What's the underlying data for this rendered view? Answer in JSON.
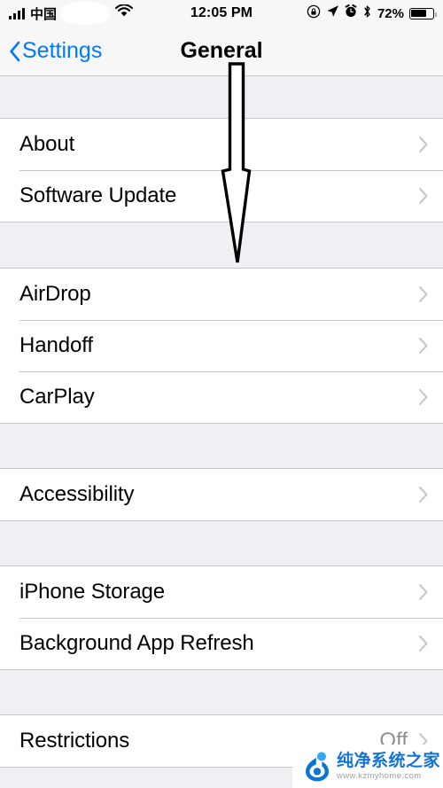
{
  "status_bar": {
    "carrier": "中国",
    "signal_icon": "signal-bars-icon",
    "wifi_icon": "wifi-icon",
    "time": "12:05 PM",
    "rotation_lock_icon": "rotation-lock-icon",
    "location_icon": "location-arrow-icon",
    "alarm_icon": "alarm-clock-icon",
    "bluetooth_icon": "bluetooth-icon",
    "battery_percent": "72%",
    "battery_level": 72
  },
  "nav_bar": {
    "back_label": "Settings",
    "back_icon": "chevron-left-icon",
    "title": "General"
  },
  "groups": [
    {
      "rows": [
        {
          "label": "About",
          "value": "",
          "accessory": "chevron-right-icon"
        },
        {
          "label": "Software Update",
          "value": "",
          "accessory": "chevron-right-icon"
        }
      ]
    },
    {
      "rows": [
        {
          "label": "AirDrop",
          "value": "",
          "accessory": "chevron-right-icon"
        },
        {
          "label": "Handoff",
          "value": "",
          "accessory": "chevron-right-icon"
        },
        {
          "label": "CarPlay",
          "value": "",
          "accessory": "chevron-right-icon"
        }
      ]
    },
    {
      "rows": [
        {
          "label": "Accessibility",
          "value": "",
          "accessory": "chevron-right-icon"
        }
      ]
    },
    {
      "rows": [
        {
          "label": "iPhone Storage",
          "value": "",
          "accessory": "chevron-right-icon"
        },
        {
          "label": "Background App Refresh",
          "value": "",
          "accessory": "chevron-right-icon"
        }
      ]
    },
    {
      "rows": [
        {
          "label": "Restrictions",
          "value": "Off",
          "accessory": "chevron-right-icon"
        }
      ]
    }
  ],
  "annotation": {
    "type": "down-arrow",
    "color": "#000000",
    "fill": "#ffffff"
  },
  "watermark": {
    "title": "纯净系统之家",
    "url": "www.kzmyhome.com",
    "logo_icon": "kzmyhome-logo-icon",
    "accent_color": "#1273d6"
  },
  "colors": {
    "accent": "#007aff",
    "page_background": "#efeff4",
    "row_background": "#ffffff",
    "separator": "#c8c7cc",
    "value_text": "#8e8e93"
  }
}
